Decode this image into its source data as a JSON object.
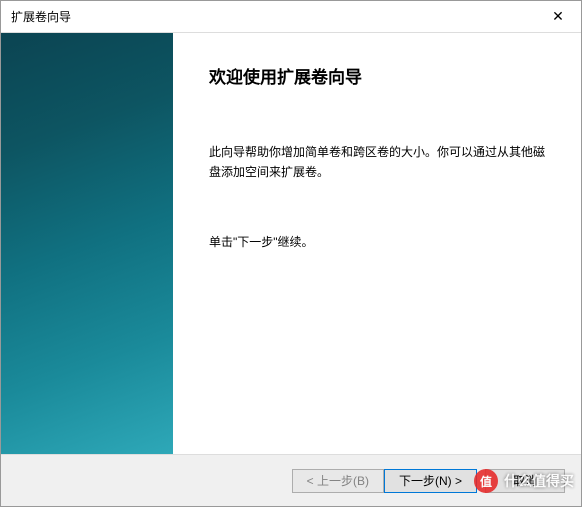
{
  "titlebar": {
    "title": "扩展卷向导",
    "close_glyph": "✕"
  },
  "wizard": {
    "heading": "欢迎使用扩展卷向导",
    "description": "此向导帮助你增加简单卷和跨区卷的大小。你可以通过从其他磁盘添加空间来扩展卷。",
    "instruction": "单击\"下一步\"继续。"
  },
  "buttons": {
    "back": "< 上一步(B)",
    "next": "下一步(N) >",
    "cancel": "取消"
  },
  "watermark": {
    "logo_text": "值",
    "text": "什么值得买"
  }
}
